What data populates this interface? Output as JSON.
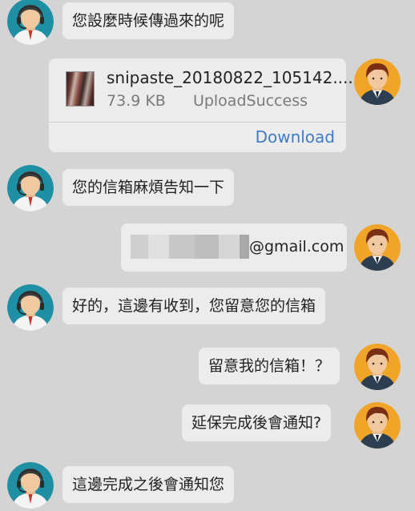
{
  "messages": [
    {
      "id": "m1",
      "side": "left",
      "text": "您設麼時候傳過來的呢"
    },
    {
      "id": "m2",
      "side": "right",
      "type": "file",
      "file": {
        "name": "snipaste_20180822_105142....",
        "size": "73.9 KB",
        "status": "UploadSuccess",
        "action": "Download"
      }
    },
    {
      "id": "m3",
      "side": "left",
      "text": "您的信箱麻煩告知一下"
    },
    {
      "id": "m4",
      "side": "right",
      "text": "@gmail.com",
      "redacted_prefix": true
    },
    {
      "id": "m5",
      "side": "left",
      "text": "好的，這邊有收到，您留意您的信箱"
    },
    {
      "id": "m6",
      "side": "right",
      "text": "留意我的信箱！？"
    },
    {
      "id": "m7",
      "side": "right",
      "text": "延保完成後會通知?"
    },
    {
      "id": "m8",
      "side": "left",
      "text": "這邊完成之後會通知您"
    }
  ],
  "avatars": {
    "agent": "support-agent-avatar",
    "customer": "customer-avatar"
  },
  "colors": {
    "background": "#d4d4d4",
    "bubble": "#ececec",
    "link": "#3f7cc4",
    "agent_bg": "#1f8fa3",
    "customer_bg": "#f1a528"
  }
}
